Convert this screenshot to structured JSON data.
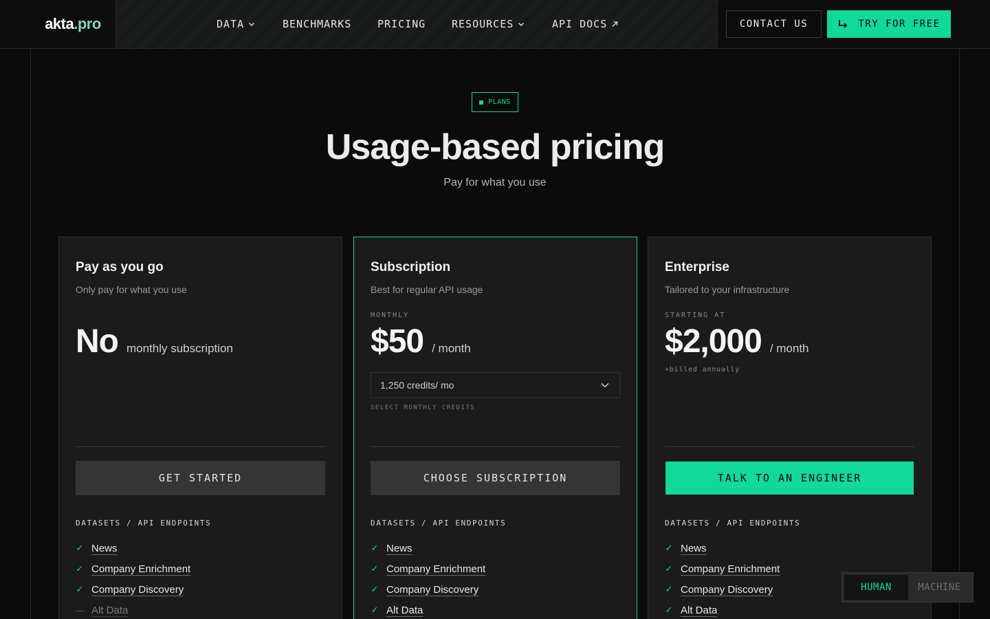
{
  "brand": {
    "name_main": "akta",
    "name_suffix": ".pro"
  },
  "nav": {
    "items": [
      {
        "label": "DATA",
        "has_dropdown": true
      },
      {
        "label": "BENCHMARKS",
        "has_dropdown": false
      },
      {
        "label": "PRICING",
        "has_dropdown": false
      },
      {
        "label": "RESOURCES",
        "has_dropdown": true
      },
      {
        "label": "API DOCS",
        "external": true
      }
    ],
    "contact_label": "CONTACT US",
    "try_label": "TRY FOR FREE"
  },
  "hero": {
    "badge": "PLANS",
    "title": "Usage-based pricing",
    "subtitle": "Pay for what you use"
  },
  "colors": {
    "accent": "#12d89a",
    "card_bg": "#1b1b1b",
    "page_bg": "#0b0b0b"
  },
  "plans": [
    {
      "title": "Pay as you go",
      "description": "Only pay for what you use",
      "price": "No",
      "price_suffix": "monthly subscription",
      "cta": "GET STARTED",
      "features_heading": "DATASETS / API ENDPOINTS",
      "features": [
        {
          "label": "News",
          "included": true
        },
        {
          "label": "Company Enrichment",
          "included": true
        },
        {
          "label": "Company Discovery",
          "included": true
        },
        {
          "label": "Alt Data",
          "included": false
        }
      ]
    },
    {
      "title": "Subscription",
      "description": "Best for regular API usage",
      "price_label": "MONTHLY",
      "price": "$50",
      "price_suffix": "/ month",
      "credits_selected": "1,250 credits/ mo",
      "credits_hint": "SELECT MONTHLY CREDITS",
      "cta": "CHOOSE SUBSCRIPTION",
      "features_heading": "DATASETS / API ENDPOINTS",
      "features": [
        {
          "label": "News",
          "included": true
        },
        {
          "label": "Company Enrichment",
          "included": true
        },
        {
          "label": "Company Discovery",
          "included": true
        },
        {
          "label": "Alt Data",
          "included": true
        }
      ]
    },
    {
      "title": "Enterprise",
      "description": "Tailored to your infrastructure",
      "price_label": "STARTING AT",
      "price": "$2,000",
      "price_suffix": "/ month",
      "billing_note": "+billed annually",
      "cta": "TALK TO AN ENGINEER",
      "features_heading": "DATASETS / API ENDPOINTS",
      "features": [
        {
          "label": "News",
          "included": true
        },
        {
          "label": "Company Enrichment",
          "included": true
        },
        {
          "label": "Company Discovery",
          "included": true
        },
        {
          "label": "Alt Data",
          "included": true
        }
      ]
    }
  ],
  "icons": {
    "check": "✓",
    "dash": "—",
    "chevron": "chevron-down-icon",
    "external": "arrow-up-right-icon",
    "try": "corner-down-right-icon"
  },
  "mode_toggle": {
    "options": [
      "HUMAN",
      "MACHINE"
    ],
    "selected": "HUMAN"
  }
}
